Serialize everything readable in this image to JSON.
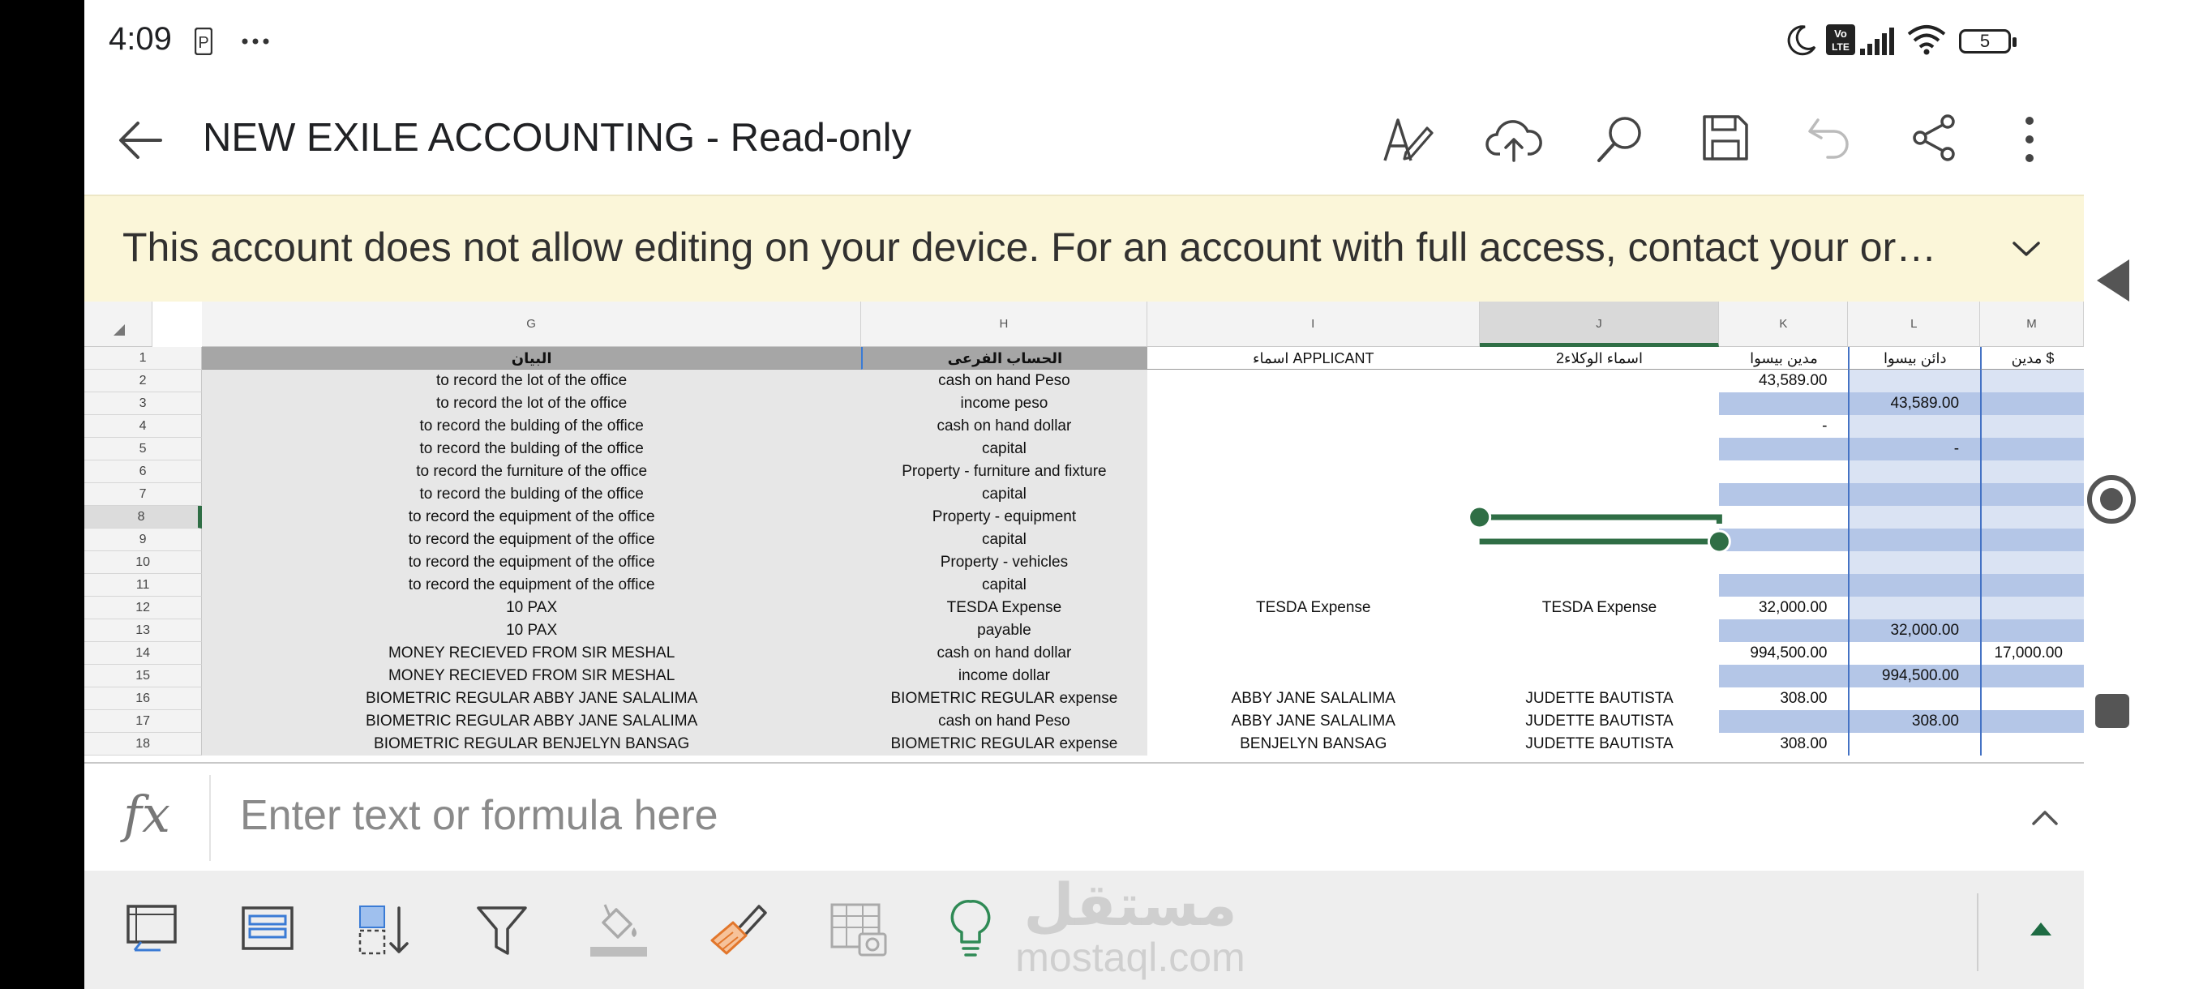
{
  "status_bar": {
    "time": "4:09",
    "battery": "5",
    "icons": [
      "p-app-icon",
      "more-dots-icon",
      "moon-icon",
      "volte-icon",
      "signal-icon",
      "wifi-icon",
      "battery-icon"
    ]
  },
  "app_bar": {
    "title": "NEW EXILE ACCOUNTING - Read-only",
    "icons": [
      "back-arrow-icon",
      "pen-icon",
      "cloud-upload-icon",
      "search-icon",
      "save-icon",
      "undo-icon",
      "share-icon",
      "more-vert-icon"
    ]
  },
  "banner": {
    "text": "This account does not allow editing on your device. For an account with full access, contact your or…",
    "icon": "chevron-down-icon"
  },
  "grid": {
    "columns": [
      "G",
      "H",
      "I",
      "J",
      "K",
      "L",
      "M"
    ],
    "rows": [
      {
        "n": "1",
        "g": "البيان",
        "h": "الحساب الفرعى",
        "i": "اسماء APPLICANT",
        "j": "اسماء الوكلاء2",
        "k": "مدين بيسوا",
        "l": "دائن بيسوا",
        "m": "مدين $"
      },
      {
        "n": "2",
        "g": "to record the lot of the office",
        "h": "cash on hand Peso",
        "i": "",
        "j": "",
        "k": "43,589.00",
        "l": "",
        "m": ""
      },
      {
        "n": "3",
        "g": "to record the lot of the office",
        "h": "income  peso",
        "i": "",
        "j": "",
        "k": "",
        "l": "43,589.00",
        "m": ""
      },
      {
        "n": "4",
        "g": "to record the bulding of the office",
        "h": "cash on hand dollar",
        "i": "",
        "j": "",
        "k": "-",
        "l": "",
        "m": ""
      },
      {
        "n": "5",
        "g": "to record the bulding of the office",
        "h": "capital",
        "i": "",
        "j": "",
        "k": "",
        "l": "-",
        "m": ""
      },
      {
        "n": "6",
        "g": "to record the furniture of the office",
        "h": "Property - furniture and fixture",
        "i": "",
        "j": "",
        "k": "",
        "l": "",
        "m": ""
      },
      {
        "n": "7",
        "g": "to record the bulding of the office",
        "h": "capital",
        "i": "",
        "j": "",
        "k": "",
        "l": "",
        "m": ""
      },
      {
        "n": "8",
        "g": "to record the  equipment of the office",
        "h": "Property  - equipment",
        "i": "",
        "j": "",
        "k": "",
        "l": "",
        "m": ""
      },
      {
        "n": "9",
        "g": "to record the  equipment of the office",
        "h": "capital",
        "i": "",
        "j": "",
        "k": "",
        "l": "",
        "m": ""
      },
      {
        "n": "10",
        "g": "to record the  equipment of the office",
        "h": "Property  - vehicles",
        "i": "",
        "j": "",
        "k": "",
        "l": "",
        "m": ""
      },
      {
        "n": "11",
        "g": "to record the  equipment of the office",
        "h": "capital",
        "i": "",
        "j": "",
        "k": "",
        "l": "",
        "m": ""
      },
      {
        "n": "12",
        "g": "10 PAX",
        "h": "TESDA Expense",
        "i": "TESDA Expense",
        "j": "TESDA Expense",
        "k": "32,000.00",
        "l": "",
        "m": ""
      },
      {
        "n": "13",
        "g": "10 PAX",
        "h": "payable",
        "i": "",
        "j": "",
        "k": "",
        "l": "32,000.00",
        "m": ""
      },
      {
        "n": "14",
        "g": "MONEY RECIEVED FROM SIR MESHAL",
        "h": "cash on hand dollar",
        "i": "",
        "j": "",
        "k": "994,500.00",
        "l": "",
        "m": "17,000.00"
      },
      {
        "n": "15",
        "g": "MONEY RECIEVED FROM SIR MESHAL",
        "h": "income  dollar",
        "i": "",
        "j": "",
        "k": "",
        "l": "994,500.00",
        "m": ""
      },
      {
        "n": "16",
        "g": "BIOMETRIC REGULAR ABBY JANE SALALIMA",
        "h": "BIOMETRIC REGULAR expense",
        "i": "ABBY JANE SALALIMA",
        "j": "JUDETTE BAUTISTA",
        "k": "308.00",
        "l": "",
        "m": ""
      },
      {
        "n": "17",
        "g": "BIOMETRIC REGULAR ABBY JANE SALALIMA",
        "h": "cash on hand Peso",
        "i": "ABBY JANE SALALIMA",
        "j": "JUDETTE BAUTISTA",
        "k": "",
        "l": "308.00",
        "m": ""
      },
      {
        "n": "18",
        "g": "BIOMETRIC REGULAR  BENJELYN BANSAG",
        "h": "BIOMETRIC REGULAR expense",
        "i": "BENJELYN BANSAG",
        "j": "JUDETTE BAUTISTA",
        "k": "308.00",
        "l": "",
        "m": ""
      }
    ]
  },
  "formula_bar": {
    "fx_label": "fx",
    "placeholder": "Enter text or formula here"
  },
  "bottom_toolbar": {
    "icons": [
      "freeze-panes-icon",
      "table-icon",
      "sort-icon",
      "filter-icon",
      "format-fill-icon",
      "format-painter-icon",
      "picture-table-icon",
      "lightbulb-icon",
      "collapse-up-icon"
    ],
    "watermark_ar": "مستقل",
    "watermark_en": "mostaql.com"
  },
  "colors": {
    "banner_bg": "#fbf6d9",
    "header_gray": "#a6a6a6",
    "selection_green": "#2f6e45",
    "band_blue": "#b4c6e7",
    "band_light": "#dae3f3",
    "cell_gray": "#e7e7e7"
  }
}
